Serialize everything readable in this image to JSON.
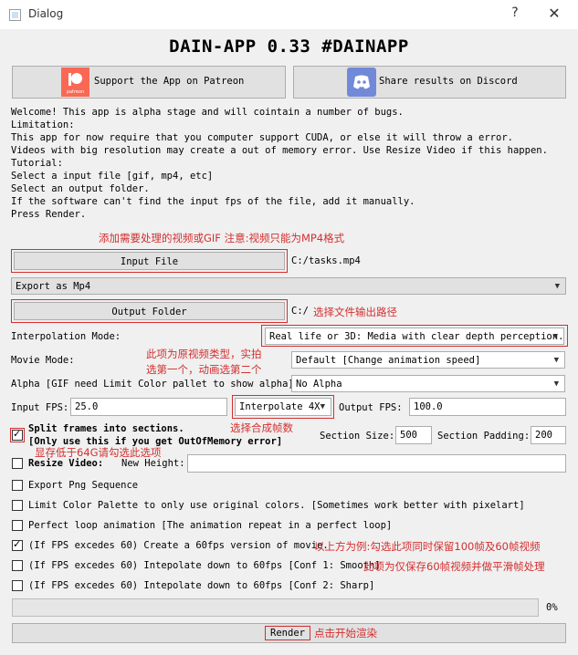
{
  "window": {
    "title": "Dialog",
    "help_glyph": "?",
    "close_glyph": "✕"
  },
  "heading": "DAIN-APP 0.33 #DAINAPP",
  "patreon_button": {
    "label": "Support the App on Patreon",
    "logo_text": "patreon",
    "color": "#f96854"
  },
  "discord_button": {
    "label": "Share results on Discord",
    "color": "#7289da"
  },
  "info_lines": [
    "Welcome! This app is alpha stage and will cointain a number of bugs.",
    "",
    "Limitation:",
    "This app for now require that you computer support CUDA, or else it will throw a error.",
    "Videos with big resolution may create a out of memory error. Use Resize Video if this happen.",
    "",
    "Tutorial:",
    "Select a input file [gif, mp4, etc]",
    "Select an output folder.",
    "If the software can't find the input fps of the file, add it manually.",
    "Press Render."
  ],
  "annotations": {
    "press_render_note": "添加需要处理的视频或GIF 注意:视频只能为MP4格式",
    "output_note": "选择文件输出路径",
    "movie_mode_note_1": "此项为原视频类型，实拍",
    "movie_mode_note_2": "选第一个，动画选第二个",
    "interp_note": "选择合成帧数",
    "split_note": "显存低于64G请勾选此选项",
    "fps60_note": "以上方为例:勾选此项同时保留100帧及60帧视频",
    "smooth_note": "此项为仅保存60帧视频并做平滑帧处理",
    "render_note": "点击开始渲染"
  },
  "input_file": {
    "button": "Input File",
    "path": "C:/tasks.mp4"
  },
  "export_select": {
    "value": "Export as Mp4"
  },
  "output_folder": {
    "button": "Output Folder",
    "path": "C:/"
  },
  "interpolation_mode": {
    "label": "Interpolation Mode:",
    "value": "Real life or 3D: Media with clear depth perception."
  },
  "movie_mode": {
    "label": "Movie Mode:",
    "value": "Default [Change animation speed]"
  },
  "alpha": {
    "label": "Alpha [GIF need Limit Color pallet to show alpha]:",
    "value": "No Alpha"
  },
  "input_fps": {
    "label": "Input FPS:",
    "value": "25.0"
  },
  "interpolate": {
    "value": "Interpolate 4X"
  },
  "output_fps": {
    "label": "Output FPS:",
    "value": "100.0"
  },
  "split_frames": {
    "checked": true,
    "label_line1": "Split frames into sections.",
    "label_line2": "[Only use this if you get OutOfMemory error]"
  },
  "section_size": {
    "label": "Section Size:",
    "value": "500"
  },
  "section_padding": {
    "label": "Section Padding:",
    "value": "200"
  },
  "resize_video": {
    "checked": false,
    "label": "Resize Video:",
    "height_label": "New Height:",
    "height_value": ""
  },
  "options": [
    {
      "checked": false,
      "label": "Export Png Sequence"
    },
    {
      "checked": false,
      "label": "Limit Color Palette to only use original colors. [Sometimes work better with pixelart]"
    },
    {
      "checked": false,
      "label": "Perfect loop animation [The animation repeat in a perfect loop]"
    },
    {
      "checked": true,
      "label": "(If FPS excedes 60) Create a 60fps version of movie."
    },
    {
      "checked": false,
      "label": "(If FPS excedes 60) Intepolate down to 60fps [Conf 1: Smooth]"
    },
    {
      "checked": false,
      "label": "(If FPS excedes 60) Intepolate down to 60fps [Conf 2: Sharp]"
    }
  ],
  "progress": {
    "value": 0,
    "text": "0%"
  },
  "render_button": {
    "label": "Render"
  },
  "colors": {
    "annotation": "#d32f2f",
    "window_bg": "#f0f0f0"
  }
}
